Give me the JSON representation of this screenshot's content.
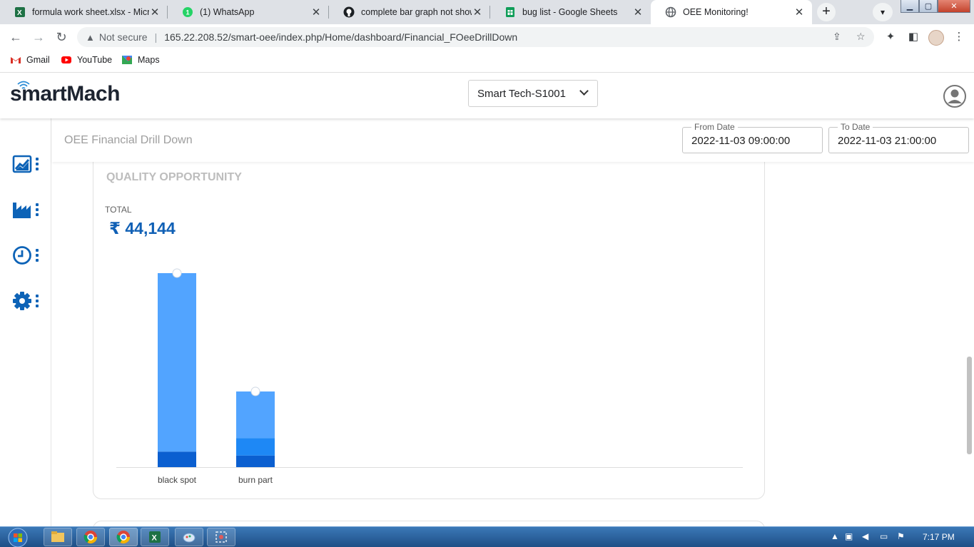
{
  "browser": {
    "tabs": [
      {
        "title": "formula work sheet.xlsx - Micro",
        "icon": "excel-icon",
        "active": false
      },
      {
        "title": "(1) WhatsApp",
        "icon": "whatsapp-icon",
        "active": false
      },
      {
        "title": "complete bar graph not shown",
        "icon": "github-icon",
        "active": false
      },
      {
        "title": "bug list - Google Sheets",
        "icon": "sheets-icon",
        "active": false
      },
      {
        "title": "OEE Monitoring!",
        "icon": "globe-icon",
        "active": true
      }
    ],
    "security_label": "Not secure",
    "url": "165.22.208.52/smart-oee/index.php/Home/dashboard/Financial_FOeeDrillDown",
    "bookmarks": [
      {
        "label": "Gmail",
        "icon": "gmail-icon"
      },
      {
        "label": "YouTube",
        "icon": "youtube-icon"
      },
      {
        "label": "Maps",
        "icon": "maps-icon"
      }
    ]
  },
  "app": {
    "logo_text": "smartMach",
    "machine_select": "Smart Tech-S1001",
    "page_title": "OEE Financial Drill Down",
    "from_date": {
      "label": "From Date",
      "value": "2022-11-03 09:00:00"
    },
    "to_date": {
      "label": "To Date",
      "value": "2022-11-03 21:00:00"
    },
    "sidebar": [
      {
        "name": "dashboard-chart-icon"
      },
      {
        "name": "factory-icon"
      },
      {
        "name": "clock-icon"
      },
      {
        "name": "settings-gear-icon"
      }
    ]
  },
  "card": {
    "title": "QUALITY OPPORTUNITY",
    "total_label": "TOTAL",
    "total_value": "₹ 44,144"
  },
  "colors": {
    "accent": "#1060b5",
    "bar_light": "#52a4ff",
    "bar_mid": "#1e88f5",
    "bar_dark": "#0b5fd0"
  },
  "chart_data": {
    "type": "bar",
    "stacked": true,
    "categories": [
      "black spot",
      "burn part"
    ],
    "series": [
      {
        "values": [
          0.08,
          0.06
        ],
        "color": "#0b5fd0"
      },
      {
        "values": [
          0,
          0.09
        ],
        "color": "#1e88f5"
      },
      {
        "values": [
          0.92,
          0.24
        ],
        "color": "#52a4ff"
      }
    ],
    "ylim": [
      0,
      1
    ],
    "grid": false,
    "legend": "none"
  },
  "taskbar": {
    "clock": "7:17 PM"
  }
}
